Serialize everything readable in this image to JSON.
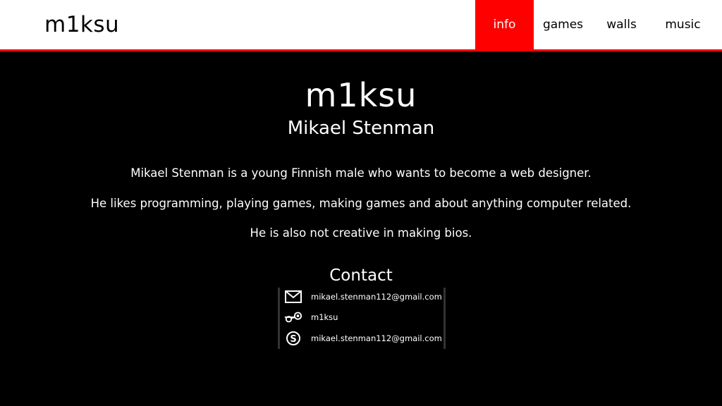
{
  "header": {
    "brand": "m1ksu",
    "nav": [
      {
        "label": "info",
        "active": true
      },
      {
        "label": "games",
        "active": false
      },
      {
        "label": "walls",
        "active": false
      },
      {
        "label": "music",
        "active": false
      }
    ]
  },
  "profile": {
    "handle": "m1ksu",
    "full_name": "Mikael Stenman",
    "bio": [
      "Mikael Stenman is a young Finnish male who wants to become a web designer.",
      "He likes programming, playing games, making games and about anything computer related.",
      "He is also not creative in making bios."
    ]
  },
  "contact": {
    "title": "Contact",
    "items": [
      {
        "icon": "mail-icon",
        "text": "mikael.stenman112@gmail.com"
      },
      {
        "icon": "steam-icon",
        "text": "m1ksu"
      },
      {
        "icon": "skype-icon",
        "text": "mikael.stenman112@gmail.com"
      }
    ]
  },
  "colors": {
    "accent": "#ff0000",
    "background": "#000000",
    "header_bg": "#ffffff"
  }
}
